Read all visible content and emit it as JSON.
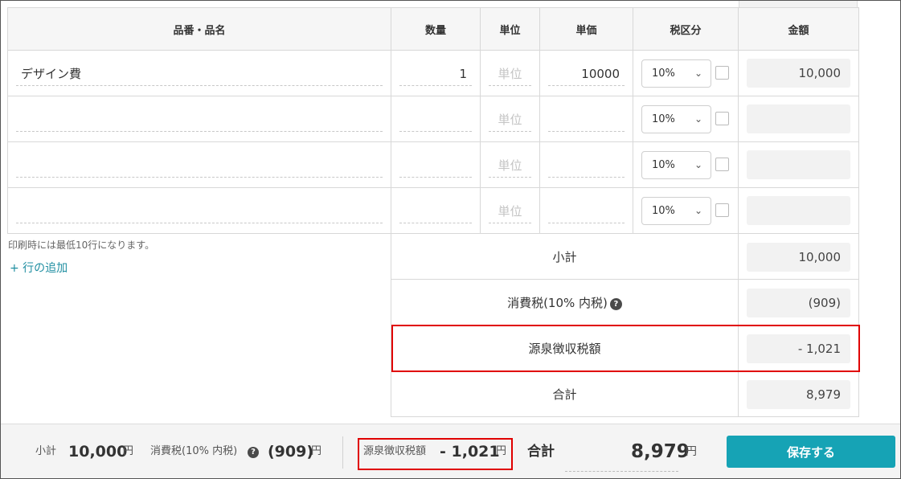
{
  "table": {
    "headers": [
      "品番・品名",
      "数量",
      "単位",
      "単価",
      "税区分",
      "金額"
    ],
    "unit_placeholder": "単位",
    "rows": [
      {
        "name": "デザイン費",
        "qty": "1",
        "price": "10000",
        "tax": "10%",
        "amount": "10,000"
      },
      {
        "name": "",
        "qty": "",
        "price": "",
        "tax": "10%",
        "amount": ""
      },
      {
        "name": "",
        "qty": "",
        "price": "",
        "tax": "10%",
        "amount": ""
      },
      {
        "name": "",
        "qty": "",
        "price": "",
        "tax": "10%",
        "amount": ""
      }
    ]
  },
  "note": "印刷時には最低10行になります。",
  "add_row": "+ 行の追加",
  "summary": {
    "subtotal_label": "小計",
    "subtotal_value": "10,000",
    "tax_label": "消費税(10% 内税)",
    "tax_value": "(909)",
    "withholding_label": "源泉徴収税額",
    "withholding_value": "- 1,021",
    "total_label": "合計",
    "total_value": "8,979"
  },
  "footer": {
    "subtotal_label": "小計",
    "subtotal_value": "10,000",
    "yen": "円",
    "tax_label": "消費税(10% 内税)",
    "tax_value": "(909)",
    "withholding_label": "源泉徴収税額",
    "withholding_value": "- 1,021",
    "total_label": "合計",
    "total_value": "8,979",
    "save_label": "保存する"
  },
  "icons": {
    "help": "question-circle-icon",
    "dropdown": "chevron-down-icon"
  },
  "colors": {
    "accent": "#16a3b5",
    "highlight": "#e00000",
    "link": "#1f8ea1"
  }
}
